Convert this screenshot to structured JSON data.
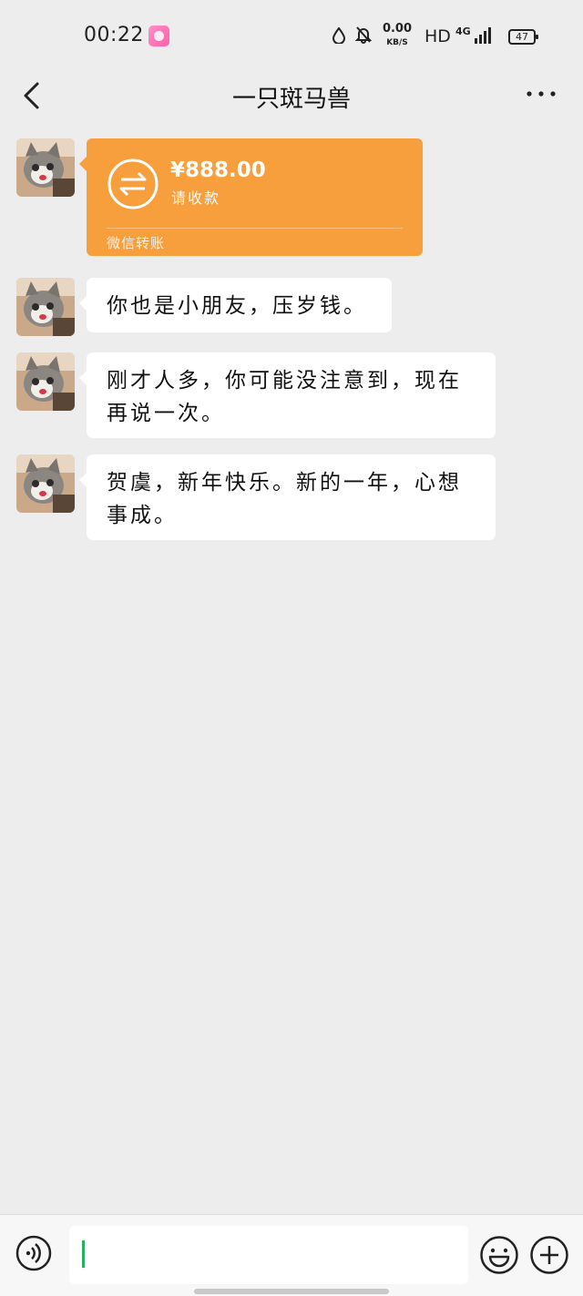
{
  "status_bar": {
    "time": "00:22",
    "speed_value": "0.00",
    "speed_unit": "KB/S",
    "hd": "HD",
    "network": "4G",
    "battery": "47"
  },
  "nav": {
    "title": "一只斑马兽"
  },
  "transfer": {
    "amount": "¥888.00",
    "status": "请收款",
    "label": "微信转账",
    "color": "#f79e3d"
  },
  "messages": [
    {
      "text": "你也是小朋友，压岁钱。"
    },
    {
      "text": "刚才人多，你可能没注意到，现在再说一次。"
    },
    {
      "text": "贺虞，新年快乐。新的一年，心想事成。"
    }
  ],
  "input": {
    "value": ""
  },
  "colors": {
    "background": "#ededed",
    "bubble": "#ffffff",
    "caret": "#2aae67"
  }
}
